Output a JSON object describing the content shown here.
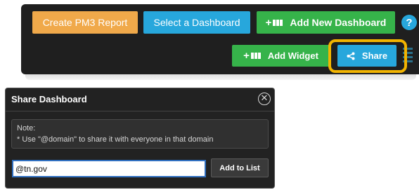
{
  "toolbar": {
    "create_report_label": "Create PM3 Report",
    "select_dashboard_label": "Select a Dashboard",
    "add_dashboard_label": "Add New Dashboard",
    "add_widget_label": "Add Widget",
    "share_label": "Share",
    "help_label": "?",
    "add_icon_glyph": "+"
  },
  "dialog": {
    "title": "Share Dashboard",
    "close_glyph": "✕",
    "note_title": "Note:",
    "note_text": "* Use \"@domain\" to share it with everyone in that domain",
    "input_value": "@tn.gov",
    "add_button_label": "Add to List"
  },
  "colors": {
    "orange": "#f0a94a",
    "blue": "#27a7dc",
    "green": "#36b34a",
    "highlight": "#f2b400",
    "toolbar_bg": "#1f1f1f",
    "dialog_bg": "#222222"
  },
  "icons": [
    "plus-grid-icon",
    "share-icon",
    "help-icon",
    "close-icon",
    "drag-handle-icon"
  ]
}
